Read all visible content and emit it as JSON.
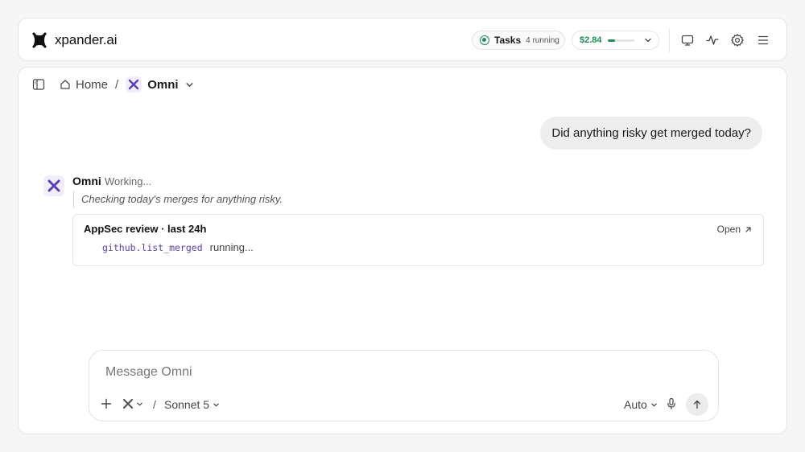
{
  "header": {
    "brand_name": "xpander.ai",
    "tasks": {
      "label": "Tasks",
      "count": "4 running"
    },
    "cost": {
      "value": "$2.84",
      "progress_fraction": 0.3
    },
    "icons": [
      "monitor-icon",
      "activity-icon",
      "gear-icon",
      "menu-icon"
    ]
  },
  "breadcrumb": {
    "home": "Home",
    "separator": "/",
    "current": "Omni"
  },
  "conversation": {
    "user_message": "Did anything risky get merged today?",
    "agent": {
      "name": "Omni",
      "status": "Working...",
      "thought": "Checking today's merges for anything risky."
    },
    "tool_card": {
      "title": "AppSec review · last 24h",
      "open_label": "Open",
      "function": "github.list_merged",
      "state": "running..."
    }
  },
  "composer": {
    "placeholder": "Message Omni",
    "separator": "/",
    "model": "Sonnet 5",
    "mode": "Auto"
  },
  "colors": {
    "accent_green": "#1e8f5a",
    "accent_purple": "#5b3fb8"
  }
}
